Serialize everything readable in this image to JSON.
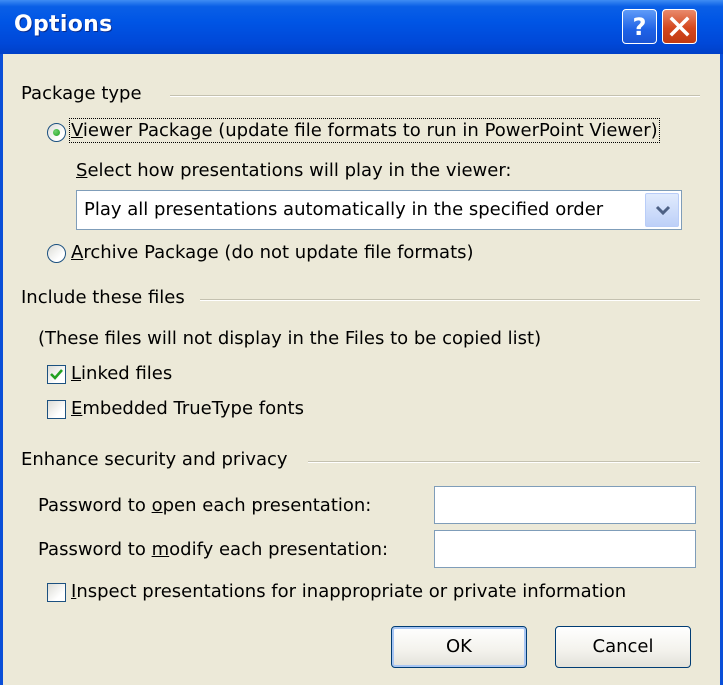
{
  "window": {
    "title": "Options",
    "help_glyph": "?",
    "close_glyph": "✕"
  },
  "package_type": {
    "group_label": "Package type",
    "viewer_option": {
      "accel": "V",
      "rest": "iewer Package (update file formats to run in PowerPoint Viewer)",
      "selected": true
    },
    "play_label": {
      "accel": "S",
      "rest": "elect how presentations will play in the viewer:"
    },
    "play_select_value": "Play all presentations automatically in the specified order",
    "archive_option": {
      "accel": "A",
      "rest": "rchive Package (do not update file formats)",
      "selected": false
    }
  },
  "include_files": {
    "group_label": "Include these files",
    "note": "(These files will not display in the Files to be copied list)",
    "linked_files": {
      "accel": "L",
      "rest": "inked files",
      "checked": true
    },
    "embedded_fonts": {
      "accel": "E",
      "rest": "mbedded TrueType fonts",
      "checked": false
    }
  },
  "security": {
    "group_label": "Enhance security and privacy",
    "open_password": {
      "pre": "Password to ",
      "accel": "o",
      "post": "pen each presentation:",
      "value": ""
    },
    "modify_password": {
      "pre": "Password to ",
      "accel": "m",
      "post": "odify each presentation:",
      "value": ""
    },
    "inspect": {
      "accel": "I",
      "rest": "nspect presentations for inappropriate or private information",
      "checked": false
    }
  },
  "buttons": {
    "ok": "OK",
    "cancel": "Cancel"
  },
  "colors": {
    "titlebar": "#0055e5",
    "dialog_bg": "#ece9d8",
    "radio_dot": "#21a121",
    "check_mark": "#21a121"
  }
}
